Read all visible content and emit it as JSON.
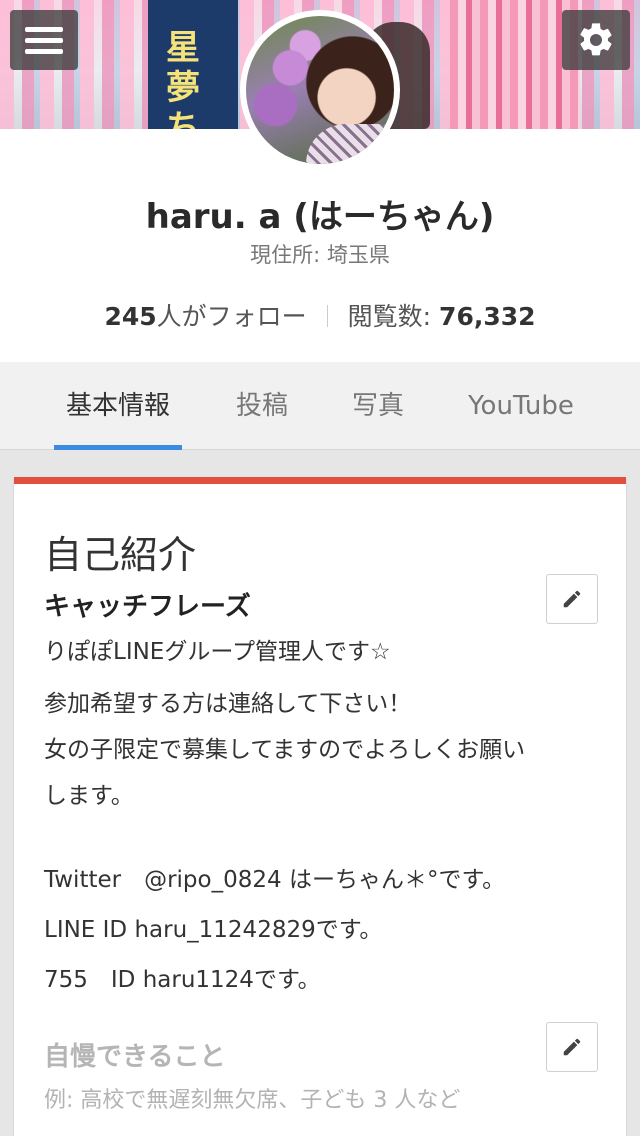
{
  "profile": {
    "name": "haru. a (はーちゃん)",
    "location": "現住所: 埼玉県",
    "following_count": "245",
    "following_suffix": "人がフォロー",
    "views_label": "閲覧数: ",
    "views_count": "76,332"
  },
  "cover": {
    "banner_text": "星夢ち"
  },
  "tabs": [
    {
      "label": "基本情報",
      "active": true
    },
    {
      "label": "投稿",
      "active": false
    },
    {
      "label": "写真",
      "active": false
    },
    {
      "label": "YouTube",
      "active": false
    }
  ],
  "card": {
    "title": "自己紹介",
    "catchphrase": {
      "title": "キャッチフレーズ",
      "text": "りぽぽLINEグループ管理人です☆"
    },
    "body_lines": [
      "参加希望する方は連絡して下さい！",
      "女の子限定で募集してますのでよろしくお願い",
      "します。",
      "Twitter　@ripo_0824  はーちゃん＊°です。",
      "LINE  ID   haru_11242829です。",
      "755　ID   haru1124です。"
    ],
    "pride": {
      "title": "自慢できること",
      "placeholder": "例: 高校で無遅刻無欠席、子ども 3 人など"
    }
  },
  "colors": {
    "accent_blue": "#3b8be0",
    "card_top_red": "#e0503d"
  }
}
